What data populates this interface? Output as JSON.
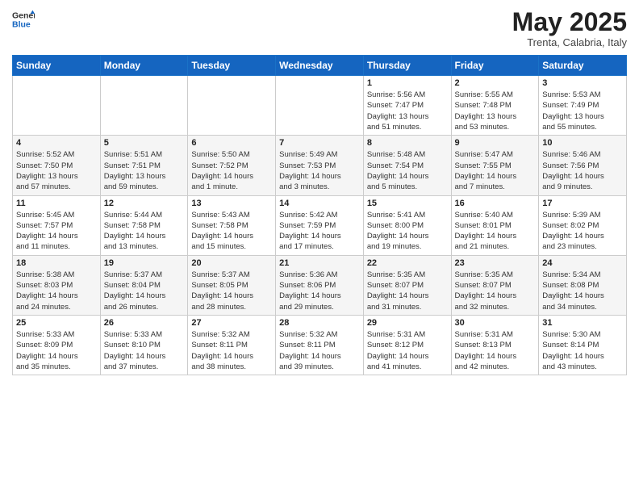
{
  "header": {
    "logo_general": "General",
    "logo_blue": "Blue",
    "title": "May 2025",
    "location": "Trenta, Calabria, Italy"
  },
  "weekdays": [
    "Sunday",
    "Monday",
    "Tuesday",
    "Wednesday",
    "Thursday",
    "Friday",
    "Saturday"
  ],
  "weeks": [
    [
      {
        "day": "",
        "detail": ""
      },
      {
        "day": "",
        "detail": ""
      },
      {
        "day": "",
        "detail": ""
      },
      {
        "day": "",
        "detail": ""
      },
      {
        "day": "1",
        "detail": "Sunrise: 5:56 AM\nSunset: 7:47 PM\nDaylight: 13 hours\nand 51 minutes."
      },
      {
        "day": "2",
        "detail": "Sunrise: 5:55 AM\nSunset: 7:48 PM\nDaylight: 13 hours\nand 53 minutes."
      },
      {
        "day": "3",
        "detail": "Sunrise: 5:53 AM\nSunset: 7:49 PM\nDaylight: 13 hours\nand 55 minutes."
      }
    ],
    [
      {
        "day": "4",
        "detail": "Sunrise: 5:52 AM\nSunset: 7:50 PM\nDaylight: 13 hours\nand 57 minutes."
      },
      {
        "day": "5",
        "detail": "Sunrise: 5:51 AM\nSunset: 7:51 PM\nDaylight: 13 hours\nand 59 minutes."
      },
      {
        "day": "6",
        "detail": "Sunrise: 5:50 AM\nSunset: 7:52 PM\nDaylight: 14 hours\nand 1 minute."
      },
      {
        "day": "7",
        "detail": "Sunrise: 5:49 AM\nSunset: 7:53 PM\nDaylight: 14 hours\nand 3 minutes."
      },
      {
        "day": "8",
        "detail": "Sunrise: 5:48 AM\nSunset: 7:54 PM\nDaylight: 14 hours\nand 5 minutes."
      },
      {
        "day": "9",
        "detail": "Sunrise: 5:47 AM\nSunset: 7:55 PM\nDaylight: 14 hours\nand 7 minutes."
      },
      {
        "day": "10",
        "detail": "Sunrise: 5:46 AM\nSunset: 7:56 PM\nDaylight: 14 hours\nand 9 minutes."
      }
    ],
    [
      {
        "day": "11",
        "detail": "Sunrise: 5:45 AM\nSunset: 7:57 PM\nDaylight: 14 hours\nand 11 minutes."
      },
      {
        "day": "12",
        "detail": "Sunrise: 5:44 AM\nSunset: 7:58 PM\nDaylight: 14 hours\nand 13 minutes."
      },
      {
        "day": "13",
        "detail": "Sunrise: 5:43 AM\nSunset: 7:58 PM\nDaylight: 14 hours\nand 15 minutes."
      },
      {
        "day": "14",
        "detail": "Sunrise: 5:42 AM\nSunset: 7:59 PM\nDaylight: 14 hours\nand 17 minutes."
      },
      {
        "day": "15",
        "detail": "Sunrise: 5:41 AM\nSunset: 8:00 PM\nDaylight: 14 hours\nand 19 minutes."
      },
      {
        "day": "16",
        "detail": "Sunrise: 5:40 AM\nSunset: 8:01 PM\nDaylight: 14 hours\nand 21 minutes."
      },
      {
        "day": "17",
        "detail": "Sunrise: 5:39 AM\nSunset: 8:02 PM\nDaylight: 14 hours\nand 23 minutes."
      }
    ],
    [
      {
        "day": "18",
        "detail": "Sunrise: 5:38 AM\nSunset: 8:03 PM\nDaylight: 14 hours\nand 24 minutes."
      },
      {
        "day": "19",
        "detail": "Sunrise: 5:37 AM\nSunset: 8:04 PM\nDaylight: 14 hours\nand 26 minutes."
      },
      {
        "day": "20",
        "detail": "Sunrise: 5:37 AM\nSunset: 8:05 PM\nDaylight: 14 hours\nand 28 minutes."
      },
      {
        "day": "21",
        "detail": "Sunrise: 5:36 AM\nSunset: 8:06 PM\nDaylight: 14 hours\nand 29 minutes."
      },
      {
        "day": "22",
        "detail": "Sunrise: 5:35 AM\nSunset: 8:07 PM\nDaylight: 14 hours\nand 31 minutes."
      },
      {
        "day": "23",
        "detail": "Sunrise: 5:35 AM\nSunset: 8:07 PM\nDaylight: 14 hours\nand 32 minutes."
      },
      {
        "day": "24",
        "detail": "Sunrise: 5:34 AM\nSunset: 8:08 PM\nDaylight: 14 hours\nand 34 minutes."
      }
    ],
    [
      {
        "day": "25",
        "detail": "Sunrise: 5:33 AM\nSunset: 8:09 PM\nDaylight: 14 hours\nand 35 minutes."
      },
      {
        "day": "26",
        "detail": "Sunrise: 5:33 AM\nSunset: 8:10 PM\nDaylight: 14 hours\nand 37 minutes."
      },
      {
        "day": "27",
        "detail": "Sunrise: 5:32 AM\nSunset: 8:11 PM\nDaylight: 14 hours\nand 38 minutes."
      },
      {
        "day": "28",
        "detail": "Sunrise: 5:32 AM\nSunset: 8:11 PM\nDaylight: 14 hours\nand 39 minutes."
      },
      {
        "day": "29",
        "detail": "Sunrise: 5:31 AM\nSunset: 8:12 PM\nDaylight: 14 hours\nand 41 minutes."
      },
      {
        "day": "30",
        "detail": "Sunrise: 5:31 AM\nSunset: 8:13 PM\nDaylight: 14 hours\nand 42 minutes."
      },
      {
        "day": "31",
        "detail": "Sunrise: 5:30 AM\nSunset: 8:14 PM\nDaylight: 14 hours\nand 43 minutes."
      }
    ]
  ]
}
